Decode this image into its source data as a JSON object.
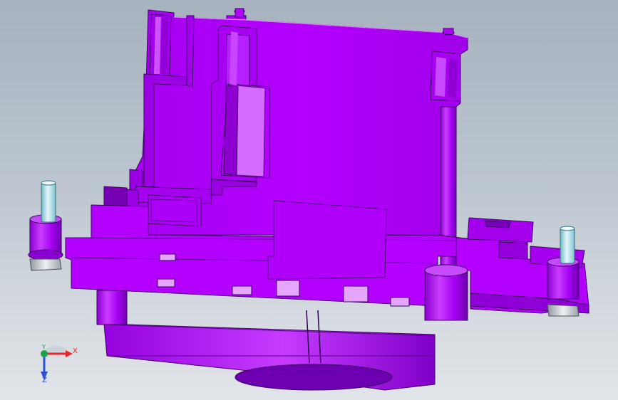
{
  "viewport": {
    "background_top": "#a7b2bf",
    "background_bottom": "#e1e4e8"
  },
  "model": {
    "body_color": "#b400ff",
    "body_dark": "#7a00bd",
    "edge_color": "#3a0060",
    "pin_color": "#a8dce6",
    "nut_color": "#cfd6dc"
  },
  "triad": {
    "x_label": "X",
    "y_label": "Y",
    "z_label": "Z",
    "x_color": "#e8262a",
    "y_color": "#1aa34a",
    "z_color": "#2a4fd8"
  }
}
